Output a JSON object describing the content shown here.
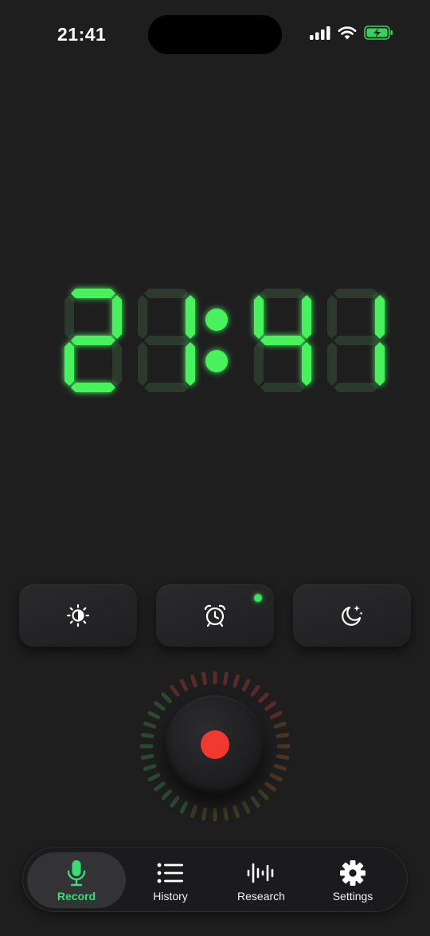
{
  "status_bar": {
    "time": "21:41",
    "icons": [
      "cellular-signal-icon",
      "wifi-icon",
      "battery-charging-icon"
    ]
  },
  "clock": {
    "display": "21:41",
    "digit_color": "#47f25c",
    "dim_segment_color": "#2b3a2d"
  },
  "controls": {
    "items": [
      {
        "icon": "brightness-icon",
        "indicator": false
      },
      {
        "icon": "alarm-clock-icon",
        "indicator": true
      },
      {
        "icon": "moon-stars-icon",
        "indicator": false
      }
    ],
    "indicator_color": "#3ae25f"
  },
  "record_button": {
    "icon": "record-dot",
    "dot_color": "#f1392f"
  },
  "tabbar": {
    "tabs": [
      {
        "label": "Record",
        "icon": "microphone-icon",
        "active": true
      },
      {
        "label": "History",
        "icon": "list-icon",
        "active": false
      },
      {
        "label": "Research",
        "icon": "waveform-icon",
        "active": false
      },
      {
        "label": "Settings",
        "icon": "gear-icon",
        "active": false
      }
    ],
    "active_color": "#3bdc75"
  }
}
